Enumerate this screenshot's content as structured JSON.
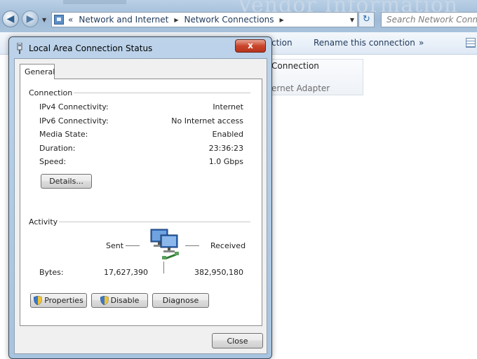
{
  "explorer": {
    "background_heading": "Vendor Information",
    "breadcrumb": [
      "«",
      "Network and Internet",
      "Network Connections"
    ],
    "search_placeholder": "Search Network Connections",
    "commands": [
      "ction",
      "Rename this connection",
      "»"
    ],
    "tile_title": "Connection",
    "tile_subtitle": "ernet Adapter"
  },
  "dialog": {
    "title": "Local Area Connection Status",
    "close_glyph": "x",
    "tab": "General",
    "connection_heading": "Connection",
    "connection": [
      {
        "label": "IPv4 Connectivity:",
        "value": "Internet"
      },
      {
        "label": "IPv6 Connectivity:",
        "value": "No Internet access"
      },
      {
        "label": "Media State:",
        "value": "Enabled"
      },
      {
        "label": "Duration:",
        "value": "23:36:23"
      },
      {
        "label": "Speed:",
        "value": "1.0 Gbps"
      }
    ],
    "details_button": "Details...",
    "activity_heading": "Activity",
    "sent_label": "Sent",
    "received_label": "Received",
    "bytes_label": "Bytes:",
    "bytes_sent": "17,627,390",
    "bytes_received": "382,950,180",
    "properties_button": "Properties",
    "disable_button": "Disable",
    "diagnose_button": "Diagnose",
    "close_button": "Close"
  },
  "icons": {
    "back": "back-arrow-icon",
    "forward": "forward-arrow-icon",
    "shield": "uac-shield-icon",
    "network": "network-computers-icon"
  },
  "colors": {
    "title_bar": "#bcd3ea",
    "close_button_red": "#c9462c",
    "link_text": "#1e395b"
  }
}
